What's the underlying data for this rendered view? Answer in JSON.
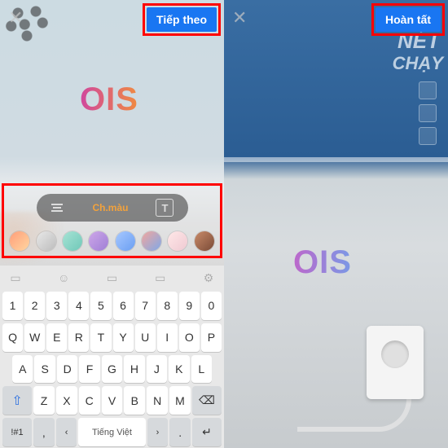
{
  "left": {
    "close_glyph": "✕",
    "next_button": "Tiếp theo",
    "overlay_text": "OIS",
    "toolbar": {
      "gradient_label": "Ch.màu",
      "font_box_glyph": "T"
    },
    "swatches": [
      "linear-gradient(135deg,#ff9e7a,#ffd6a0)",
      "linear-gradient(135deg,#e8e8e8,#bcbcbc)",
      "linear-gradient(135deg,#a7e3d5,#6fc8b8)",
      "linear-gradient(135deg,#cda7e8,#9f7ed6)",
      "linear-gradient(135deg,#a7c8ff,#6a9ef2)",
      "linear-gradient(135deg,#f2a79e,#7fa8e8)",
      "linear-gradient(135deg,#ffe8e8,#efc9d2)",
      "linear-gradient(135deg,#c98b6a,#7a4a36)"
    ],
    "keyboard": {
      "row_num": [
        "1",
        "2",
        "3",
        "4",
        "5",
        "6",
        "7",
        "8",
        "9",
        "0"
      ],
      "row1": [
        "Q",
        "W",
        "E",
        "R",
        "T",
        "Y",
        "U",
        "I",
        "O",
        "P"
      ],
      "row2": [
        "A",
        "S",
        "D",
        "F",
        "G",
        "H",
        "J",
        "K",
        "L"
      ],
      "row3": [
        "Z",
        "X",
        "C",
        "V",
        "B",
        "N",
        "M"
      ],
      "shift_glyph": "⇧",
      "backspace_glyph": "⌫",
      "sym_key": "!#1",
      "comma_key": ",",
      "lang_left_glyph": "‹",
      "space_label": "Tiếng Việt",
      "lang_right_glyph": "›",
      "period_key": ".",
      "enter_glyph": "↵",
      "settings_glyph": "⚙"
    }
  },
  "right": {
    "close_glyph": "✕",
    "done_button": "Hoàn tất",
    "overlay_text": "OIS",
    "bg_text_1": "NÉT",
    "bg_text_2": "CHẠY"
  }
}
